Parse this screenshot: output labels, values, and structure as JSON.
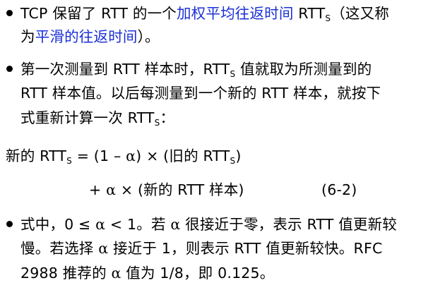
{
  "paragraph1": {
    "line1_a": "TCP 保留了 RTT 的一个",
    "line1_hl": "加权平均往返时间",
    "line1_b": " RTT",
    "line1_sub": "S",
    "line1_c": "（这又称",
    "line2_a": "为",
    "line2_hl": "平滑的往返时间",
    "line2_b": "）。"
  },
  "paragraph2": {
    "line1_a": "第一次测量到 RTT 样本时，RTT",
    "line1_sub": "S",
    "line1_b": " 值就取为所测量到的",
    "line2": "RTT 样本值。以后每测量到一个新的 RTT 样本，就按下",
    "line3_a": "式重新计算一次 RTT",
    "line3_sub": "S",
    "line3_b": "："
  },
  "formula": {
    "line1_a": "新的 RTT",
    "line1_sub": "S",
    "line1_b": " = (1 – ",
    "alpha": "α",
    "line1_c": ") × (旧的 RTT",
    "line1_sub2": "S",
    "line1_d": ")",
    "line2_a": "+ ",
    "line2_b": " × (新的 RTT 样本)",
    "equation_number": "(6-2)"
  },
  "paragraph3": {
    "line1_a": "式中，0 ≤ ",
    "line1_b": " < 1。若 ",
    "line1_c": " 很接近于零，表示 RTT 值更新较",
    "line2_a": "慢。若选择 ",
    "line2_b": " 接近于 1，则表示 RTT 值更新较快。RFC",
    "line3_a": "2988 推荐的 ",
    "line3_b": " 值为 1/8，即 0.125。"
  },
  "colors": {
    "text": "#000000",
    "highlight": "#1a2fd6",
    "background": "#ffffff"
  }
}
